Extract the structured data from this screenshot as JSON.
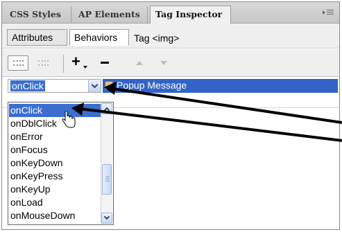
{
  "panel_tabs": [
    {
      "label": "CSS Styles"
    },
    {
      "label": "AP Elements"
    },
    {
      "label": "Tag Inspector"
    }
  ],
  "sub_tabs": [
    {
      "label": "Attributes"
    },
    {
      "label": "Behaviors"
    }
  ],
  "tag_label": "Tag <img>",
  "toolbar": {
    "show_set_events_icon": "events-list-icon",
    "show_all_events_icon": "all-events-icon",
    "add_icon": "plus-icon",
    "remove_icon": "minus-icon",
    "up_icon": "arrow-up-icon",
    "down_icon": "arrow-down-icon"
  },
  "behavior": {
    "event": "onClick",
    "action": "Popup Message"
  },
  "event_options": [
    "onClick",
    "onDblClick",
    "onError",
    "onFocus",
    "onKeyDown",
    "onKeyPress",
    "onKeyUp",
    "onLoad",
    "onMouseDown"
  ],
  "colors": {
    "selection": "#3a6fd0",
    "tab_bar": "#d0d0d0",
    "annotation_arrow": "#000000"
  }
}
